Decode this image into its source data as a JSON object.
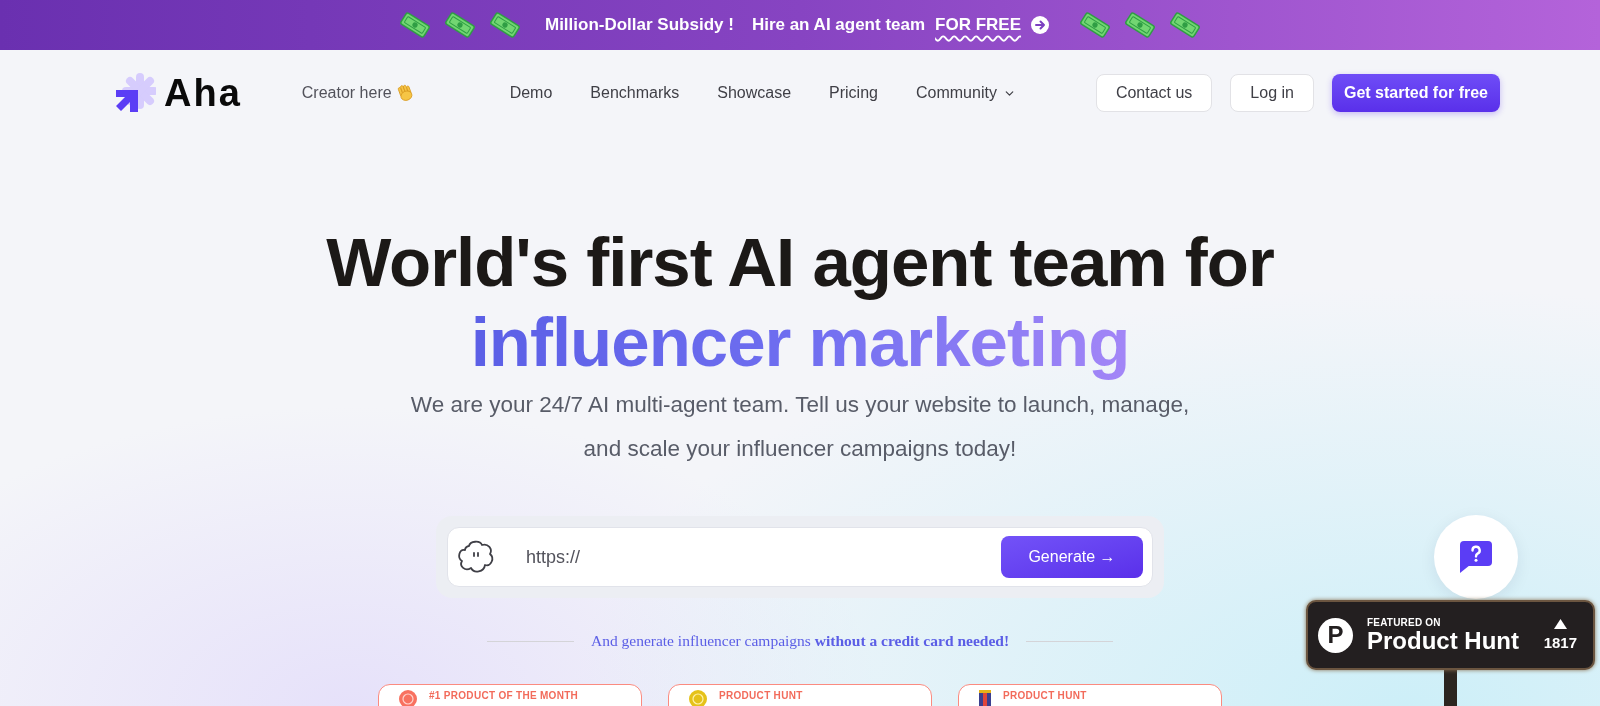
{
  "promo_banner": {
    "headline": "Million-Dollar Subsidy !",
    "offer": "Hire an AI agent team",
    "link": "FOR FREE"
  },
  "nav": {
    "logo": "Aha",
    "creator_link": "Creator here",
    "links": [
      {
        "label": "Demo",
        "kind": "link"
      },
      {
        "label": "Benchmarks",
        "kind": "link"
      },
      {
        "label": "Showcase",
        "kind": "link"
      },
      {
        "label": "Pricing",
        "kind": "link"
      },
      {
        "label": "Community",
        "kind": "dropdown"
      }
    ],
    "buttons": [
      {
        "label": "Contact us",
        "kind": "outline"
      },
      {
        "label": "Log in",
        "kind": "outline"
      },
      {
        "label": "Get started for free",
        "kind": "primary"
      }
    ]
  },
  "hero": {
    "title": "World's first AI agent team for",
    "title_highlight": "influencer marketing",
    "subtitle": "We are your 24/7 AI multi-agent team. Tell us your website to launch, manage, and scale your influencer campaigns today!",
    "url_field": {
      "placeholder": "https://"
    },
    "generate_button": "Generate →",
    "caption": "And generate influencer campaigns **without a credit card needed!**"
  },
  "awards": [
    {
      "kind": "month",
      "title": "#1 PRODUCT OF THE MONTH"
    },
    {
      "kind": "medal",
      "title": "PRODUCT HUNT"
    },
    {
      "kind": "flag",
      "title": "PRODUCT HUNT"
    }
  ],
  "product_hunt_badge": {
    "logo": "P",
    "eyebrow": "FEATURED ON",
    "name": "Product Hunt",
    "votes": "1817"
  }
}
